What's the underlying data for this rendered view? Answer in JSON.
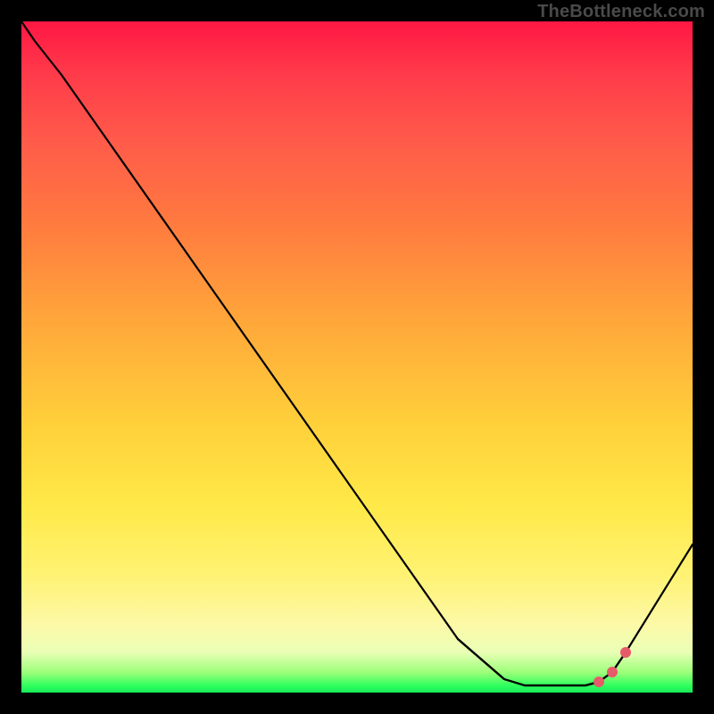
{
  "watermark": "TheBottleneck.com",
  "colors": {
    "background": "#000000",
    "gradient_top": "#ff1744",
    "gradient_mid1": "#ffa83a",
    "gradient_mid2": "#ffe948",
    "gradient_bottom": "#18e85a",
    "curve": "#000000",
    "markers": "#e65a6a"
  },
  "chart_data": {
    "type": "line",
    "title": "",
    "xlabel": "",
    "ylabel": "",
    "xlim": [
      0,
      100
    ],
    "ylim": [
      0,
      100
    ],
    "grid": false,
    "x": [
      0,
      2,
      6,
      65,
      72,
      75,
      78,
      80,
      82,
      84,
      86,
      88,
      90,
      100
    ],
    "values": [
      100,
      97,
      92,
      8,
      2,
      1,
      1,
      1,
      1,
      1,
      1.5,
      3,
      6,
      22
    ],
    "highlighted_range_x": [
      65,
      90
    ],
    "highlighted_points_x": [
      86,
      88,
      90
    ],
    "annotations": []
  }
}
